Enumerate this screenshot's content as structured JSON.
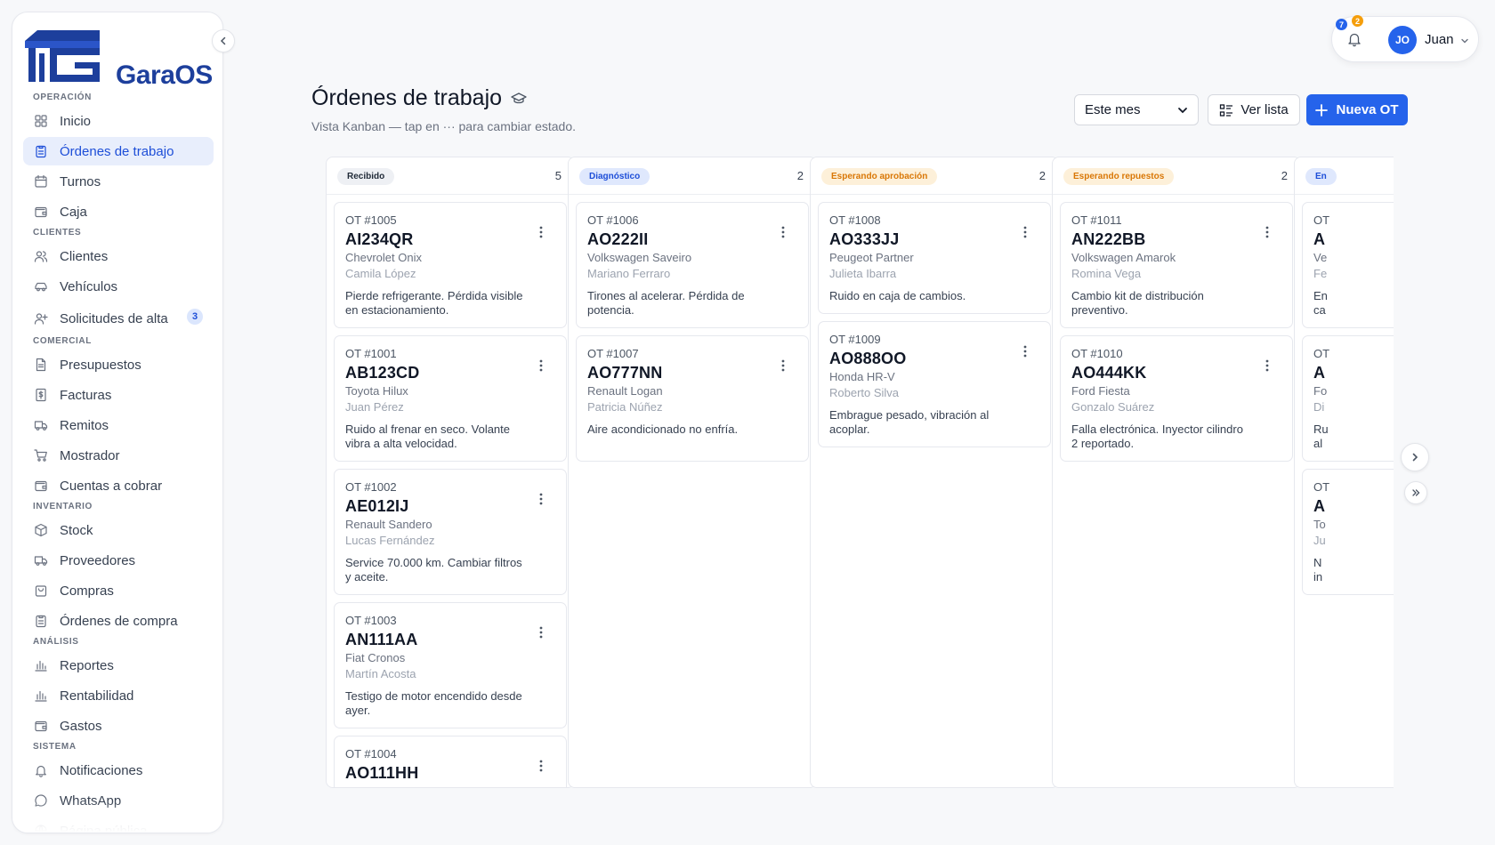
{
  "brand": {
    "name": "GaraOS"
  },
  "sidebar": {
    "sections": [
      {
        "title": "OPERACIÓN",
        "items": [
          {
            "label": "Inicio",
            "icon": "grid-icon"
          },
          {
            "label": "Órdenes de trabajo",
            "icon": "clipboard-icon",
            "active": true
          },
          {
            "label": "Turnos",
            "icon": "calendar-icon"
          },
          {
            "label": "Caja",
            "icon": "wallet-icon"
          }
        ]
      },
      {
        "title": "CLIENTES",
        "items": [
          {
            "label": "Clientes",
            "icon": "users-icon"
          },
          {
            "label": "Vehículos",
            "icon": "car-icon"
          },
          {
            "label": "Solicitudes de alta",
            "icon": "user-plus-icon",
            "badge": "3"
          }
        ]
      },
      {
        "title": "COMERCIAL",
        "items": [
          {
            "label": "Presupuestos",
            "icon": "file-text-icon"
          },
          {
            "label": "Facturas",
            "icon": "invoice-dollar-icon"
          },
          {
            "label": "Remitos",
            "icon": "truck-icon"
          },
          {
            "label": "Mostrador",
            "icon": "cart-icon"
          },
          {
            "label": "Cuentas a cobrar",
            "icon": "wallet-icon"
          }
        ]
      },
      {
        "title": "INVENTARIO",
        "items": [
          {
            "label": "Stock",
            "icon": "box-icon"
          },
          {
            "label": "Proveedores",
            "icon": "truck-icon"
          },
          {
            "label": "Compras",
            "icon": "shopping-bag-icon"
          },
          {
            "label": "Órdenes de compra",
            "icon": "clipboard-icon"
          }
        ]
      },
      {
        "title": "ANÁLISIS",
        "items": [
          {
            "label": "Reportes",
            "icon": "bar-chart-icon"
          },
          {
            "label": "Rentabilidad",
            "icon": "bar-chart-icon"
          },
          {
            "label": "Gastos",
            "icon": "wallet-icon"
          }
        ]
      },
      {
        "title": "SISTEMA",
        "items": [
          {
            "label": "Notificaciones",
            "icon": "bell-icon"
          },
          {
            "label": "WhatsApp",
            "icon": "chat-icon"
          },
          {
            "label": "Página pública",
            "icon": "globe-icon",
            "faded": true
          }
        ]
      }
    ]
  },
  "header": {
    "title": "Órdenes de trabajo",
    "subtitle": "Vista Kanban — tap en ··· para cambiar estado.",
    "period": {
      "selected": "Este mes"
    },
    "list_button": "Ver lista",
    "new_button": "Nueva OT"
  },
  "user": {
    "initials": "JO",
    "name": "Juan",
    "notif_blue": "7",
    "notif_orange": "2"
  },
  "colors": {
    "accent": "#2563eb"
  },
  "columns": [
    {
      "label": "Recibido",
      "count": "5",
      "tag_bg": "#eef0f4",
      "tag_color": "#1f2937",
      "cards": [
        {
          "ot": "OT #1005",
          "plate": "AI234QR",
          "model": "Chevrolet Onix",
          "customer": "Camila López",
          "desc": "Pierde refrigerante. Pérdida visible en estacionamiento."
        },
        {
          "ot": "OT #1001",
          "plate": "AB123CD",
          "model": "Toyota Hilux",
          "customer": "Juan Pérez",
          "desc": "Ruido al frenar en seco. Volante vibra a alta velocidad."
        },
        {
          "ot": "OT #1002",
          "plate": "AE012IJ",
          "model": "Renault Sandero",
          "customer": "Lucas Fernández",
          "desc": "Service 70.000 km. Cambiar filtros y aceite."
        },
        {
          "ot": "OT #1003",
          "plate": "AN111AA",
          "model": "Fiat Cronos",
          "customer": "Martín Acosta",
          "desc": "Testigo de motor encendido desde ayer."
        },
        {
          "ot": "OT #1004",
          "plate": "AO111HH",
          "model": "",
          "customer": "",
          "desc": ""
        }
      ]
    },
    {
      "label": "Diagnóstico",
      "count": "2",
      "tag_bg": "#dfe8fd",
      "tag_color": "#1d4ed8",
      "cards": [
        {
          "ot": "OT #1006",
          "plate": "AO222II",
          "model": "Volkswagen Saveiro",
          "customer": "Mariano Ferraro",
          "desc": "Tirones al acelerar. Pérdida de potencia."
        },
        {
          "ot": "OT #1007",
          "plate": "AO777NN",
          "model": "Renault Logan",
          "customer": "Patricia Núñez",
          "desc": "Aire acondicionado no enfría."
        }
      ]
    },
    {
      "label": "Esperando aprobación",
      "count": "2",
      "tag_bg": "#fdf0d9",
      "tag_color": "#d97706",
      "cards": [
        {
          "ot": "OT #1008",
          "plate": "AO333JJ",
          "model": "Peugeot Partner",
          "customer": "Julieta Ibarra",
          "desc": "Ruido en caja de cambios."
        },
        {
          "ot": "OT #1009",
          "plate": "AO888OO",
          "model": "Honda HR-V",
          "customer": "Roberto Silva",
          "desc": "Embrague pesado, vibración al acoplar."
        }
      ]
    },
    {
      "label": "Esperando repuestos",
      "count": "2",
      "tag_bg": "#fdf0d9",
      "tag_color": "#d97706",
      "cards": [
        {
          "ot": "OT #1011",
          "plate": "AN222BB",
          "model": "Volkswagen Amarok",
          "customer": "Romina Vega",
          "desc": "Cambio kit de distribución preventivo."
        },
        {
          "ot": "OT #1010",
          "plate": "AO444KK",
          "model": "Ford Fiesta",
          "customer": "Gonzalo Suárez",
          "desc": "Falla electrónica. Inyector cilindro 2 reportado."
        }
      ]
    },
    {
      "label": "En",
      "count": "",
      "tag_bg": "#dfe8fd",
      "tag_color": "#1d4ed8",
      "cards": [
        {
          "ot": "OT",
          "plate": "A",
          "model": "Ve",
          "customer": "Fe",
          "desc": "En ca"
        },
        {
          "ot": "OT",
          "plate": "A",
          "model": "Fo",
          "customer": "Di",
          "desc": "Ru al"
        },
        {
          "ot": "OT",
          "plate": "A",
          "model": "To",
          "customer": "Ju",
          "desc": "N in"
        }
      ]
    }
  ]
}
